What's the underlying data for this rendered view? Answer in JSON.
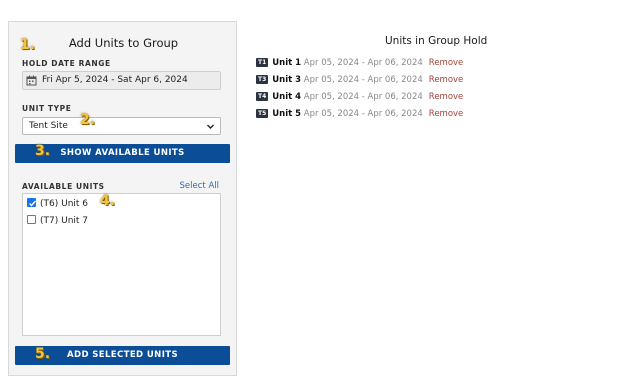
{
  "panel": {
    "title": "Add Units to Group",
    "date_range_label": "HOLD DATE RANGE",
    "date_range_value": "Fri Apr 5, 2024 - Sat Apr 6, 2024",
    "unit_type_label": "UNIT TYPE",
    "unit_type_value": "Tent Site",
    "show_button": "SHOW AVAILABLE UNITS",
    "available_label": "AVAILABLE UNITS",
    "select_all": "Select All",
    "units": [
      {
        "label": "(T6) Unit 6",
        "checked": true
      },
      {
        "label": "(T7) Unit 7",
        "checked": false
      }
    ],
    "add_button": "ADD SELECTED UNITS"
  },
  "steps": [
    "1.",
    "2.",
    "3.",
    "4.",
    "5."
  ],
  "group": {
    "title": "Units in Group Hold",
    "items": [
      {
        "tag": "T1",
        "name": "Unit 1",
        "dates": "Apr 05, 2024 - Apr 06, 2024",
        "action": "Remove"
      },
      {
        "tag": "T3",
        "name": "Unit 3",
        "dates": "Apr 05, 2024 - Apr 06, 2024",
        "action": "Remove"
      },
      {
        "tag": "T4",
        "name": "Unit 4",
        "dates": "Apr 05, 2024 - Apr 06, 2024",
        "action": "Remove"
      },
      {
        "tag": "T5",
        "name": "Unit 5",
        "dates": "Apr 05, 2024 - Apr 06, 2024",
        "action": "Remove"
      }
    ]
  },
  "colors": {
    "primary_button": "#0b4d96",
    "link": "#2a6db5",
    "remove": "#a0443a",
    "step_marker": "#f5c242"
  },
  "icons": {
    "date": "calendar-icon",
    "select": "chevron-down-icon",
    "check": "checkmark-icon"
  }
}
